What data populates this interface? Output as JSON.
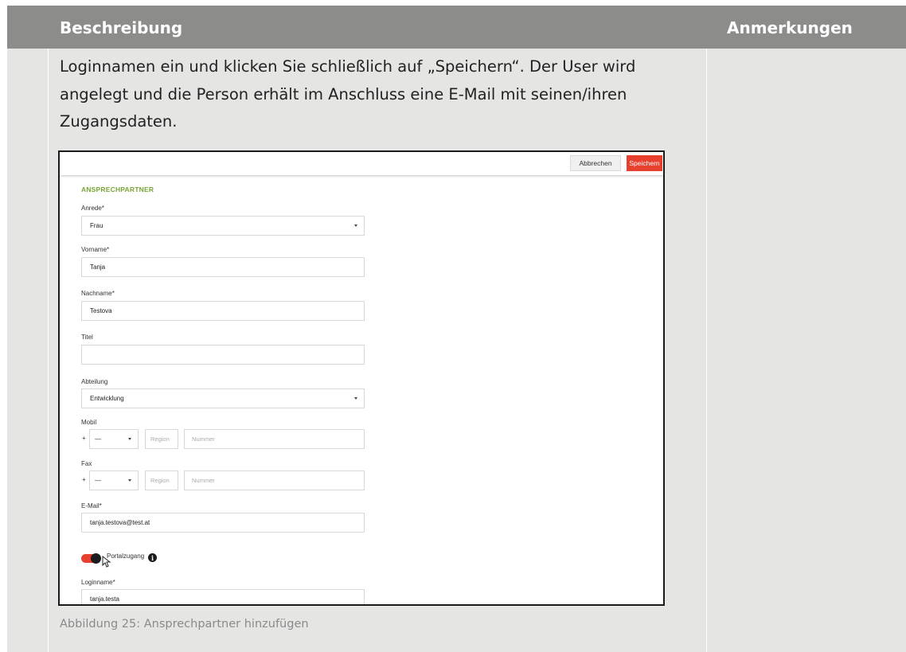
{
  "table": {
    "header_description": "Beschreibung",
    "header_notes": "Anmerkungen"
  },
  "paragraph": "Loginnamen ein und klicken Sie schließlich auf „Speichern“. Der User wird angelegt und die Person erhält im Anschluss eine E-Mail mit seinen/ihren Zugangsdaten.",
  "screenshot": {
    "cancel_label": "Abbrechen",
    "save_label": "Speichern",
    "section_title": "ANSPRECHPARTNER",
    "anrede_label": "Anrede*",
    "anrede_value": "Frau",
    "vorname_label": "Vorname*",
    "vorname_value": "Tanja",
    "nachname_label": "Nachname*",
    "nachname_value": "Testova",
    "titel_label": "Titel",
    "titel_value": "",
    "abteilung_label": "Abteilung",
    "abteilung_value": "Entwicklung",
    "mobil_label": "Mobil",
    "fax_label": "Fax",
    "plus": "+",
    "country_code_value": "—",
    "region_placeholder": "Region",
    "nummer_placeholder": "Nummer",
    "email_label": "E-Mail*",
    "email_value": "tanja.testova@test.at",
    "portal_label": "Portalzugang",
    "portal_enabled": true,
    "info_icon_glyph": "i",
    "loginname_label": "Loginname*",
    "loginname_value": "tanja.testa",
    "accent_color": "#e8402e",
    "section_color": "#7aa536"
  },
  "caption": "Abbildung 25: Ansprechpartner hinzufügen"
}
